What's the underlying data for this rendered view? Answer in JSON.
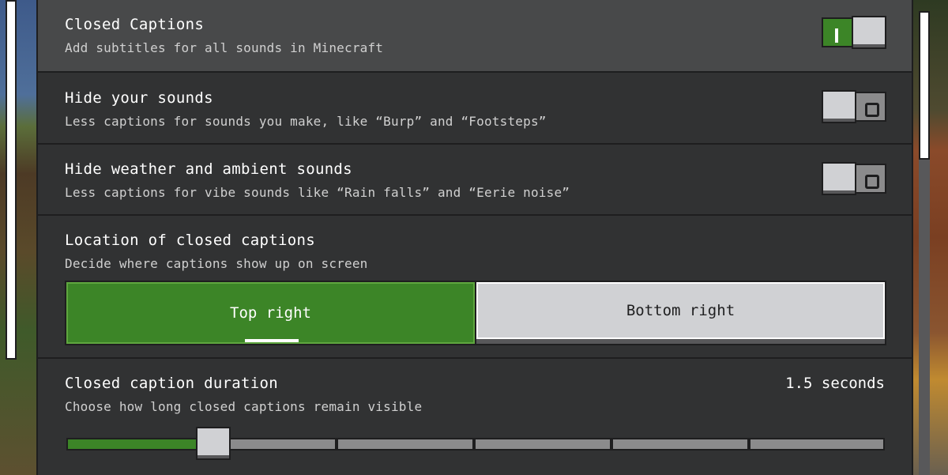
{
  "settings": [
    {
      "title": "Closed Captions",
      "description": "Add subtitles for all sounds in Minecraft",
      "toggle": "on"
    },
    {
      "title": "Hide your sounds",
      "description": "Less captions for sounds you make, like “Burp” and “Footsteps”",
      "toggle": "off"
    },
    {
      "title": "Hide weather and ambient sounds",
      "description": "Less captions for vibe sounds like “Rain falls” and “Eerie noise”",
      "toggle": "off"
    }
  ],
  "location": {
    "title": "Location of closed captions",
    "description": "Decide where captions show up on screen",
    "options": [
      "Top right",
      "Bottom right"
    ],
    "selected": "Top right"
  },
  "duration": {
    "title": "Closed caption duration",
    "description": "Choose how long closed captions remain visible",
    "value_label": "1.5 seconds",
    "slider_step": 1,
    "slider_steps_total": 6
  },
  "colors": {
    "accent_green": "#3c8527",
    "panel": "#313233",
    "highlight": "#48494a"
  }
}
